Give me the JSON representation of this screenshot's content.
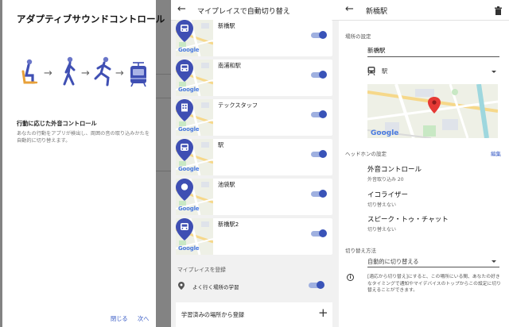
{
  "colors": {
    "accent": "#3953b8",
    "link": "#3558c4",
    "pin": "#3f4fb3"
  },
  "dialog": {
    "title": "アダプティブサウンドコントロール",
    "subtitle": "行動に応じた外音コントロール",
    "description": "あなたの行動をアプリが検出し、周囲の音の取り込みかたを自動的に切り替えます。",
    "close_label": "閉じる",
    "next_label": "次へ",
    "icons": [
      "person-sitting-icon",
      "person-walking-icon",
      "person-running-icon",
      "train-icon"
    ]
  },
  "myplaces": {
    "back": "←",
    "title": "マイプレイスで自動切り替え",
    "places": [
      {
        "name": "新橋駅",
        "icon": "train-icon",
        "enabled": true
      },
      {
        "name": "南浦和駅",
        "icon": "train-icon",
        "enabled": true
      },
      {
        "name": "テックスタッフ",
        "icon": "building-icon",
        "enabled": true
      },
      {
        "name": "駅",
        "icon": "train-icon",
        "enabled": true
      },
      {
        "name": "池袋駅",
        "icon": "location-icon",
        "enabled": true
      },
      {
        "name": "新橋駅2",
        "icon": "train-icon",
        "enabled": true
      }
    ],
    "map_logo": "Google",
    "register_section": "マイプレイスを登録",
    "learn_label": "よく行く場所の学習",
    "learn_enabled": true,
    "register_from_learned": "学習済みの場所から登録",
    "add_symbol": "+"
  },
  "detail": {
    "back": "←",
    "title": "新橋駅",
    "place_setting_label": "場所の設定",
    "name_value": "新橋駅",
    "category_label": "駅",
    "map_logo": "Google",
    "headphones_label": "ヘッドホンの設定",
    "edit_label": "編集",
    "features": [
      {
        "name": "外音コントロール",
        "value": "外音取り込み 20"
      },
      {
        "name": "イコライザー",
        "value": "切り替えない"
      },
      {
        "name": "スピーク・トゥ・チャット",
        "value": "切り替えない"
      }
    ],
    "switch_method_label": "切り替え方法",
    "switch_method_value": "自動的に切り替える",
    "info_symbol": "i",
    "info_text": "[適応から切り替え]にすると、この場所にいる間、あなたの好きなタイミングで通知やマイデバイスのトップからこの設定に切り替えることができます。"
  }
}
